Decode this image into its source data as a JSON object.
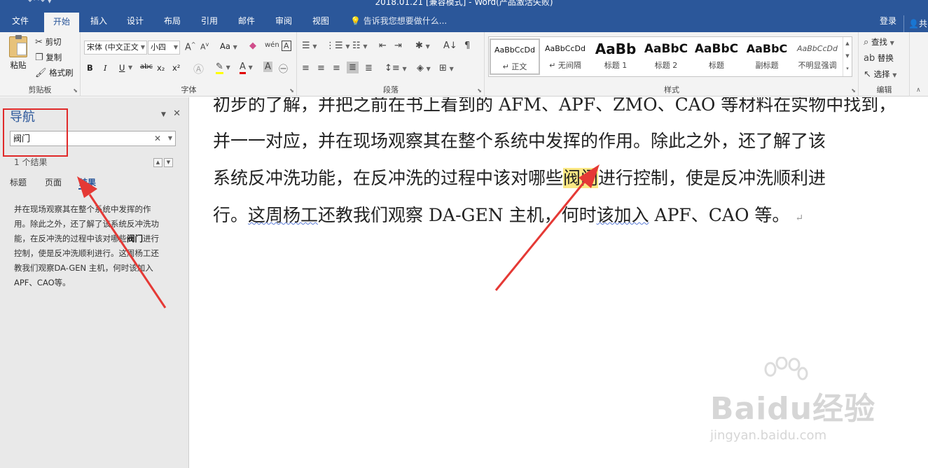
{
  "window": {
    "title": "2018.01.21 [兼容模式] - Word(产品激活失败)"
  },
  "tabs": [
    {
      "label": "文件"
    },
    {
      "label": "开始"
    },
    {
      "label": "插入"
    },
    {
      "label": "设计"
    },
    {
      "label": "布局"
    },
    {
      "label": "引用"
    },
    {
      "label": "邮件"
    },
    {
      "label": "审阅"
    },
    {
      "label": "视图"
    }
  ],
  "tellme": "告诉我您想要做什么...",
  "login": "登录",
  "share": "共",
  "clipboard": {
    "paste": "粘贴",
    "cut": "剪切",
    "copy": "复制",
    "format_painter": "格式刷",
    "label": "剪贴板"
  },
  "font": {
    "name": "宋体 (中文正文",
    "size": "小四",
    "label": "字体",
    "change_case": "Aa",
    "bold": "B",
    "italic": "I",
    "underline": "U",
    "strike": "abc",
    "sub": "x₂",
    "sup": "x²"
  },
  "paragraph": {
    "label": "段落"
  },
  "styles": {
    "label": "样式",
    "items": [
      {
        "sample": "AaBbCcDd",
        "name": "↵ 正文"
      },
      {
        "sample": "AaBbCcDd",
        "name": "↵ 无间隔"
      },
      {
        "sample": "AaBb",
        "name": "标题 1"
      },
      {
        "sample": "AaBbC",
        "name": "标题 2"
      },
      {
        "sample": "AaBbC",
        "name": "标题"
      },
      {
        "sample": "AaBbC",
        "name": "副标题"
      },
      {
        "sample": "AaBbCcDd",
        "name": "不明显强调"
      }
    ]
  },
  "editing": {
    "find": "查找",
    "replace": "替换",
    "select": "选择",
    "label": "编辑"
  },
  "nav": {
    "title": "导航",
    "search_value": "阀门",
    "result_count": "1 个结果",
    "tabs": [
      "标题",
      "页面",
      "结果"
    ],
    "result_before": "并在现场观察其在整个系统中发挥的作用。除此之外，还了解了该系统反冲洗功能，在反冲洗的过程中该对哪些",
    "result_hit": "阀门",
    "result_after": "进行控制，使是反冲洗顺利进行。这周杨工还教我们观察DA-GEN 主机，何时该加入APF、CAO等。"
  },
  "document": {
    "line1": "初步的了解，并把之前在书上看到的 AFM、APF、ZMO、CAO 等材料在实物中找到，",
    "line2": "并一一对应，并在现场观察其在整个系统中发挥的作用。除此之外，还了解了该",
    "line3_before": "系统反冲洗功能，在反冲洗的过程中该对哪些",
    "line3_hit": "阀门",
    "line3_after": "进行控制，使是反冲洗顺利进",
    "line4_a": "行。",
    "line4_b": "这周杨工",
    "line4_c": "还教我们观察 DA-GEN 主机，何时",
    "line4_d": "该加入",
    "line4_e": " APF、CAO 等。",
    "para_mark": "↵"
  },
  "watermark": {
    "brand": "Baidu经验",
    "url": "jingyan.baidu.com"
  },
  "colors": {
    "ribbon_blue": "#2b579a",
    "highlight": "#fbe884",
    "arrow_red": "#e53935"
  }
}
